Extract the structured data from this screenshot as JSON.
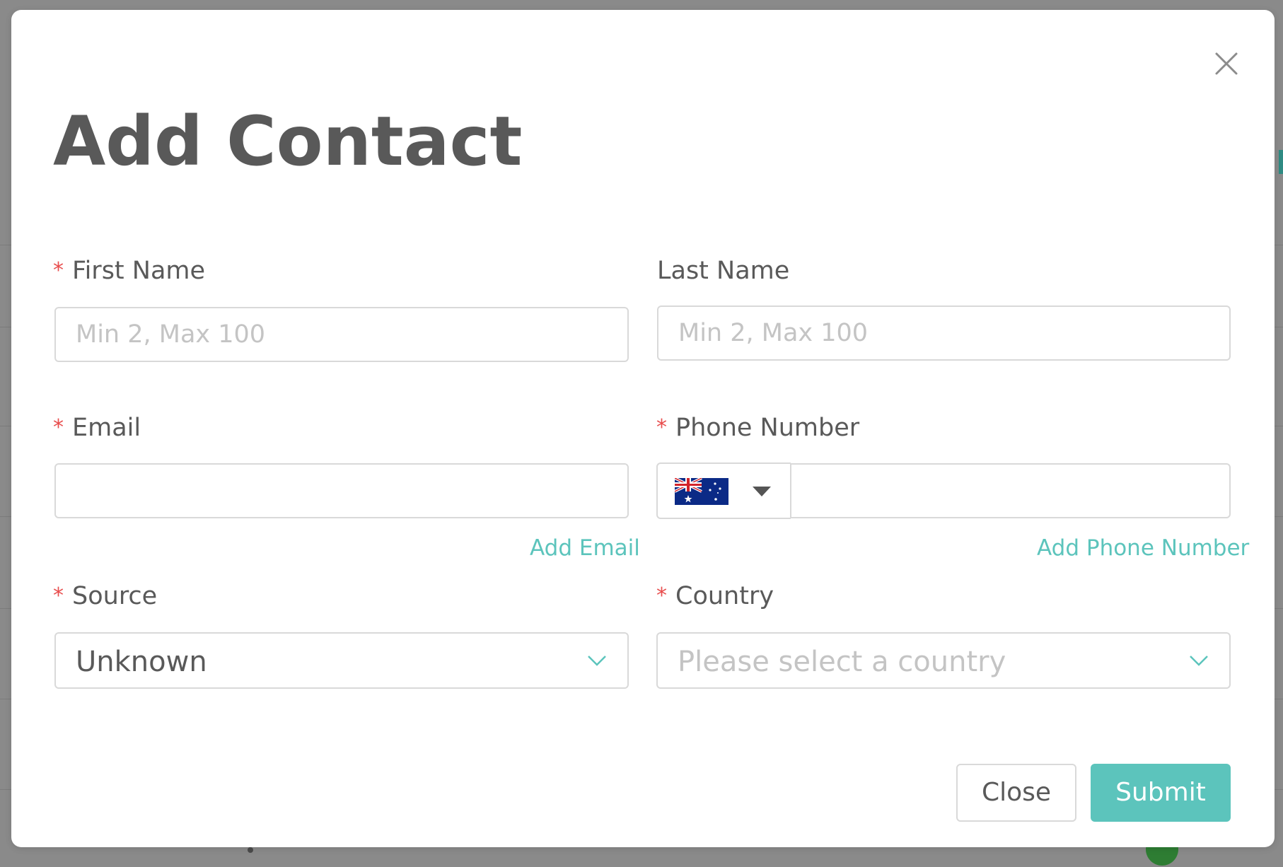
{
  "modal": {
    "title": "Add Contact",
    "close_icon": "close-icon"
  },
  "form": {
    "required_mark": "*",
    "first_name": {
      "label": "First Name",
      "placeholder": "Min 2, Max 100",
      "value": "",
      "required": true
    },
    "last_name": {
      "label": "Last Name",
      "placeholder": "Min 2, Max 100",
      "value": "",
      "required": false
    },
    "email": {
      "label": "Email",
      "value": "",
      "required": true,
      "add_link": "Add Email"
    },
    "phone": {
      "label": "Phone Number",
      "value": "",
      "required": true,
      "country_flag": "australia-flag-icon",
      "add_link": "Add Phone Number"
    },
    "source": {
      "label": "Source",
      "selected": "Unknown",
      "required": true
    },
    "country": {
      "label": "Country",
      "placeholder": "Please select a country",
      "required": true
    }
  },
  "buttons": {
    "close_label": "Close",
    "submit_label": "Submit"
  },
  "colors": {
    "accent": "#5cc4bc",
    "required": "#e84d4d",
    "text": "#595959",
    "placeholder": "#c4c4c4",
    "border": "#d9d9d9",
    "overlay": "#8a8a8a"
  }
}
